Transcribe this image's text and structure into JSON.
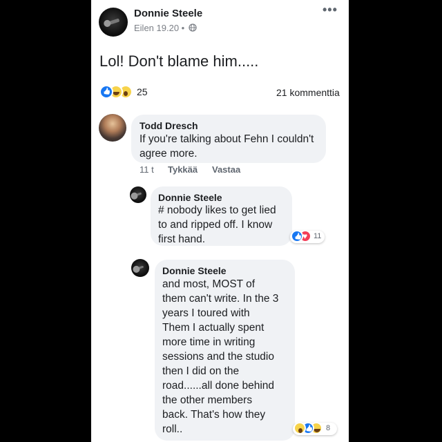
{
  "post": {
    "author": "Donnie Steele",
    "timestamp": "Eilen 19.20 •",
    "audience_icon": "globe-icon",
    "more_icon": "more-options-icon",
    "more_label": "•••",
    "text": "Lol! Don't blame him.....",
    "reactions": [
      "like",
      "haha",
      "wow"
    ],
    "reaction_count": "25",
    "comment_count": "21 kommenttia"
  },
  "comments": [
    {
      "author": "Todd Dresch",
      "text": "If you're talking about Fehn I couldn't\nagree more.",
      "time": "11 t",
      "like_label": "Tykkää",
      "reply_label": "Vastaa"
    },
    {
      "author": "Donnie Steele",
      "text": "# nobody likes to get lied\nto and ripped off. I know\nfirst hand.",
      "reactions": [
        "like",
        "love"
      ],
      "reaction_count": "11"
    },
    {
      "author": "Donnie Steele",
      "text": "and most, MOST of\nthem can't write. In the 3\nyears I toured with\nThem I actually spent\nmore time in writing\nsessions and the studio\nthen I did on the\nroad......all done behind\nthe other members\nback. That's how they\nroll..",
      "reactions": [
        "wow",
        "like",
        "haha"
      ],
      "reaction_count": "8"
    }
  ],
  "colors": {
    "like_blue": "#1877f2",
    "love_red": "#f33e58",
    "bubble_gray": "#f0f2f5"
  }
}
